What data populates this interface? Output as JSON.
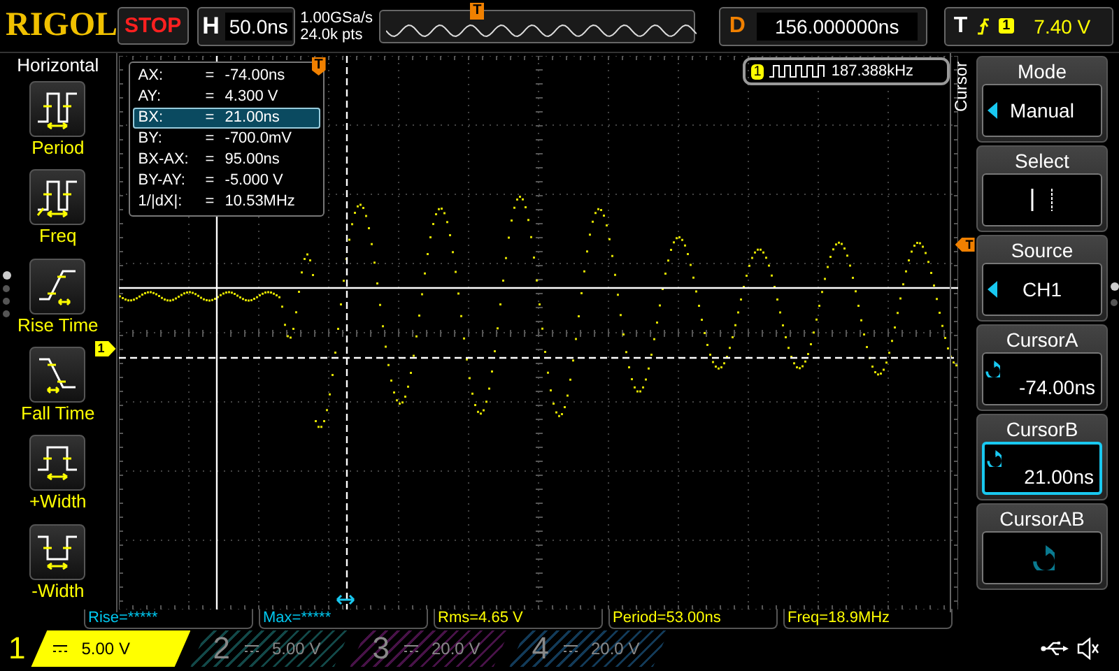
{
  "top_bar": {
    "logo": "RIGOL",
    "run_state": "STOP",
    "horizontal": {
      "label": "H",
      "timebase": "50.0ns"
    },
    "sample_rate": "1.00GSa/s",
    "memory_depth": "24.0k pts",
    "overview_marker": "T",
    "delay": {
      "label": "D",
      "value": "156.000000ns"
    },
    "trigger": {
      "label": "T",
      "source": "1",
      "level": "7.40 V"
    }
  },
  "left_menu": {
    "title": "Horizontal",
    "items": [
      {
        "label": "Period",
        "kind": "period"
      },
      {
        "label": "Freq",
        "kind": "freq"
      },
      {
        "label": "Rise Time",
        "kind": "rise"
      },
      {
        "label": "Fall Time",
        "kind": "fall"
      },
      {
        "label": "+Width",
        "kind": "pwidth"
      },
      {
        "label": "-Width",
        "kind": "nwidth"
      }
    ],
    "pages": [
      {
        "selected": true
      },
      {
        "selected": false
      },
      {
        "selected": false
      },
      {
        "selected": false
      }
    ]
  },
  "cursor_readout": [
    {
      "name": "AX:",
      "equals": "=",
      "value": "-74.00ns",
      "selected": false
    },
    {
      "name": "AY:",
      "equals": "=",
      "value": "4.300 V",
      "selected": false
    },
    {
      "name": "BX:",
      "equals": "=",
      "value": "21.00ns",
      "selected": true
    },
    {
      "name": "BY:",
      "equals": "=",
      "value": "-700.0mV",
      "selected": false
    },
    {
      "name": "BX-AX:",
      "equals": "=",
      "value": "95.00ns",
      "selected": false
    },
    {
      "name": "BY-AY:",
      "equals": "=",
      "value": "-5.000 V",
      "selected": false
    },
    {
      "name": "1/|dX|:",
      "equals": "=",
      "value": "10.53MHz",
      "selected": false
    }
  ],
  "counter": {
    "channel": "1",
    "value": "187.388kHz"
  },
  "markers": {
    "trigger_top": "T",
    "trigger_right": "T",
    "channel": "1"
  },
  "right_menu": {
    "tab": "Cursor",
    "items": [
      {
        "title": "Mode",
        "kind": "option",
        "value": "Manual",
        "selected": false
      },
      {
        "title": "Select",
        "kind": "select",
        "selected": false
      },
      {
        "title": "Source",
        "kind": "option",
        "value": "CH1",
        "selected": false
      },
      {
        "title": "CursorA",
        "kind": "knob",
        "value": "-74.00ns",
        "selected": false
      },
      {
        "title": "CursorB",
        "kind": "knob",
        "value": "21.00ns",
        "selected": true
      },
      {
        "title": "CursorAB",
        "kind": "knob",
        "selected": false
      }
    ],
    "pages": [
      {
        "selected": true
      },
      {
        "selected": false
      }
    ]
  },
  "measurements": [
    {
      "text": "Rise=*****",
      "color": "#00c8f0"
    },
    {
      "text": "Max=*****",
      "color": "#00c8f0"
    },
    {
      "text": "Rms=4.65 V",
      "color": "#ffff00"
    },
    {
      "text": "Period=53.00ns",
      "color": "#ffff00"
    },
    {
      "text": "Freq=18.9MHz",
      "color": "#ffff00"
    }
  ],
  "channels": [
    {
      "number": "1",
      "scale": "5.00 V",
      "on": true,
      "color": "#ffff00"
    },
    {
      "number": "2",
      "scale": "5.00 V",
      "on": false,
      "color": "#124848"
    },
    {
      "number": "3",
      "scale": "20.0 V",
      "on": false,
      "color": "#481248"
    },
    {
      "number": "4",
      "scale": "20.0 V",
      "on": false,
      "color": "#123a58"
    }
  ]
}
